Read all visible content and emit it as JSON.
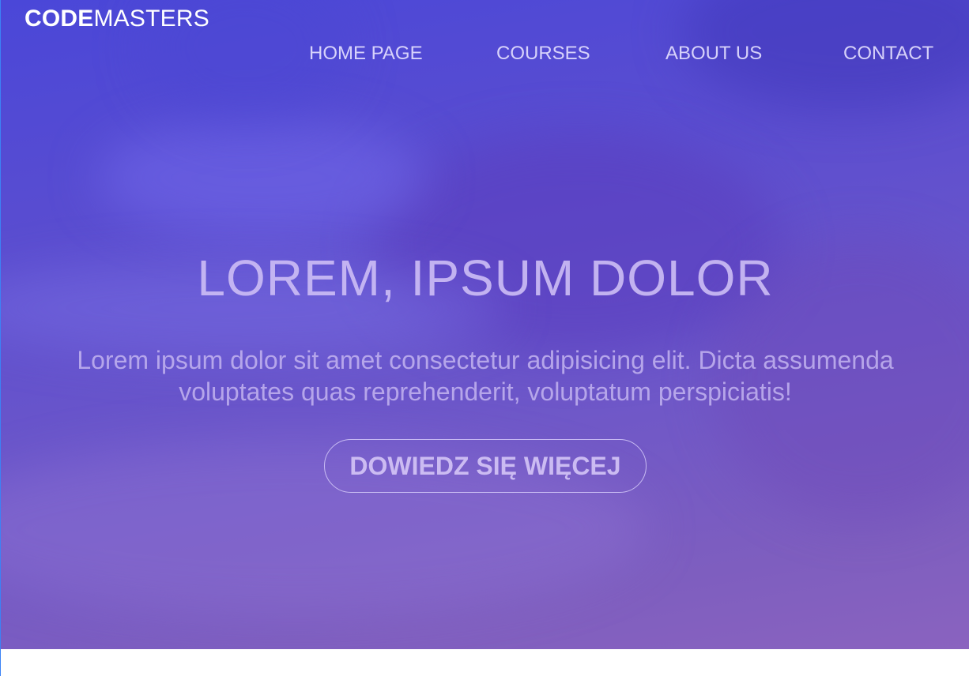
{
  "brand": {
    "bold": "CODE",
    "light": "MASTERS"
  },
  "nav": {
    "items": [
      {
        "label": "HOME PAGE"
      },
      {
        "label": "COURSES"
      },
      {
        "label": "ABOUT US"
      },
      {
        "label": "CONTACT"
      }
    ]
  },
  "hero": {
    "title": "LOREM, IPSUM DOLOR",
    "subtitle": "Lorem ipsum dolor sit amet consectetur adipisicing elit. Dicta assumenda voluptates quas reprehenderit, voluptatum perspiciatis!",
    "cta_label": "DOWIEDZ SIĘ WIĘCEJ"
  },
  "colors": {
    "hero_top": "#4a47d8",
    "hero_bottom": "#8a63bf",
    "text_light": "#ffffff",
    "section_bg": "#ffffff"
  }
}
